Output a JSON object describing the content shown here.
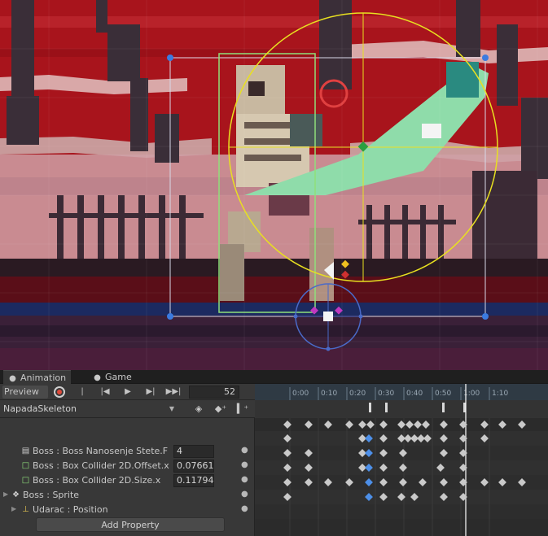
{
  "tabs": [
    {
      "label": "Animation",
      "icon": "animation-icon",
      "active": true
    },
    {
      "label": "Game",
      "icon": "gamepad-icon",
      "active": false
    }
  ],
  "toolbar": {
    "preview_label": "Preview",
    "frame_value": "52"
  },
  "clip": {
    "name": "NapadaSkeleton"
  },
  "properties": [
    {
      "label": "Boss : Boss Nanosenje Stete.F",
      "value": "4",
      "icon": "script-icon",
      "expandable": false
    },
    {
      "label": "Boss : Box Collider 2D.Offset.x",
      "value": "0.07661",
      "icon": "box-collider-icon",
      "expandable": false
    },
    {
      "label": "Boss : Box Collider 2D.Size.x",
      "value": "0.11794",
      "icon": "box-collider-icon",
      "expandable": false
    },
    {
      "label": "Boss : Sprite",
      "value": "",
      "icon": "sprite-icon",
      "expandable": true
    },
    {
      "label": "Udarac : Position",
      "value": "",
      "icon": "transform-icon",
      "expandable": true
    }
  ],
  "add_property_label": "Add Property",
  "ruler": [
    "0:00",
    "0:10",
    "0:20",
    "0:30",
    "0:40",
    "0:50",
    "1:00",
    "1:10"
  ],
  "colors": {
    "scene_red": "#a8141c",
    "gizmo_yellow": "#e8e020",
    "collider_green": "#8fe07a",
    "keyframe": "#c9c9c9",
    "keyframe_selected": "#4d8fe8",
    "playhead": "#ffffff",
    "record": "#e04a3a"
  }
}
